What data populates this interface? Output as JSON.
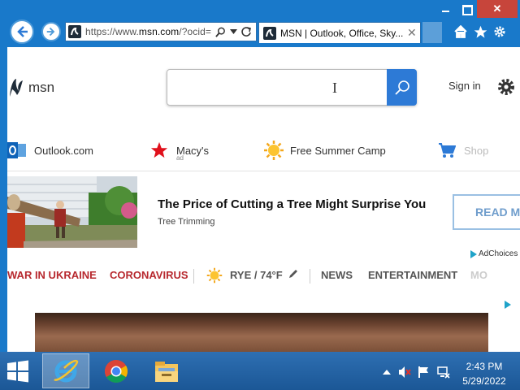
{
  "browser": {
    "window_controls": {
      "minimize": "–",
      "maximize": "□",
      "close": "✕"
    },
    "address_bar": {
      "url_prefix": "https://www.",
      "url_domain": "msn.com",
      "url_rest": "/?ocid="
    },
    "tab": {
      "title": "MSN | Outlook, Office, Sky...",
      "close": "✕"
    }
  },
  "page": {
    "logo": {
      "text": "msn"
    },
    "search": {
      "value": "",
      "placeholder": ""
    },
    "signin_label": "Sign in",
    "quicklinks": [
      {
        "label": "Outlook.com",
        "icon": "outlook-icon"
      },
      {
        "label": "Macy's",
        "sub": "ad",
        "icon": "macys-star-icon"
      },
      {
        "label": "Free Summer Camp",
        "icon": "sun-icon"
      },
      {
        "label": "Shop",
        "icon": "cart-icon"
      }
    ],
    "ad": {
      "headline": "The Price of Cutting a Tree Might Surprise You",
      "sub": "Tree Trimming",
      "cta": "READ M",
      "adchoices": "AdChoices"
    },
    "topics": [
      {
        "label": "WAR IN UKRAINE",
        "style": "red"
      },
      {
        "label": "CORONAVIRUS",
        "style": "red"
      },
      {
        "label": "RYE / 74°F",
        "style": "weather"
      },
      {
        "label": "NEWS",
        "style": "gray"
      },
      {
        "label": "ENTERTAINMENT",
        "style": "gray"
      },
      {
        "label": "MO",
        "style": "gray"
      }
    ]
  },
  "taskbar": {
    "clock_time": "2:43 PM",
    "clock_date": "5/29/2022"
  },
  "colors": {
    "accent": "#1979ca",
    "search_button": "#2d7ad6",
    "topic_red": "#b7282e"
  }
}
